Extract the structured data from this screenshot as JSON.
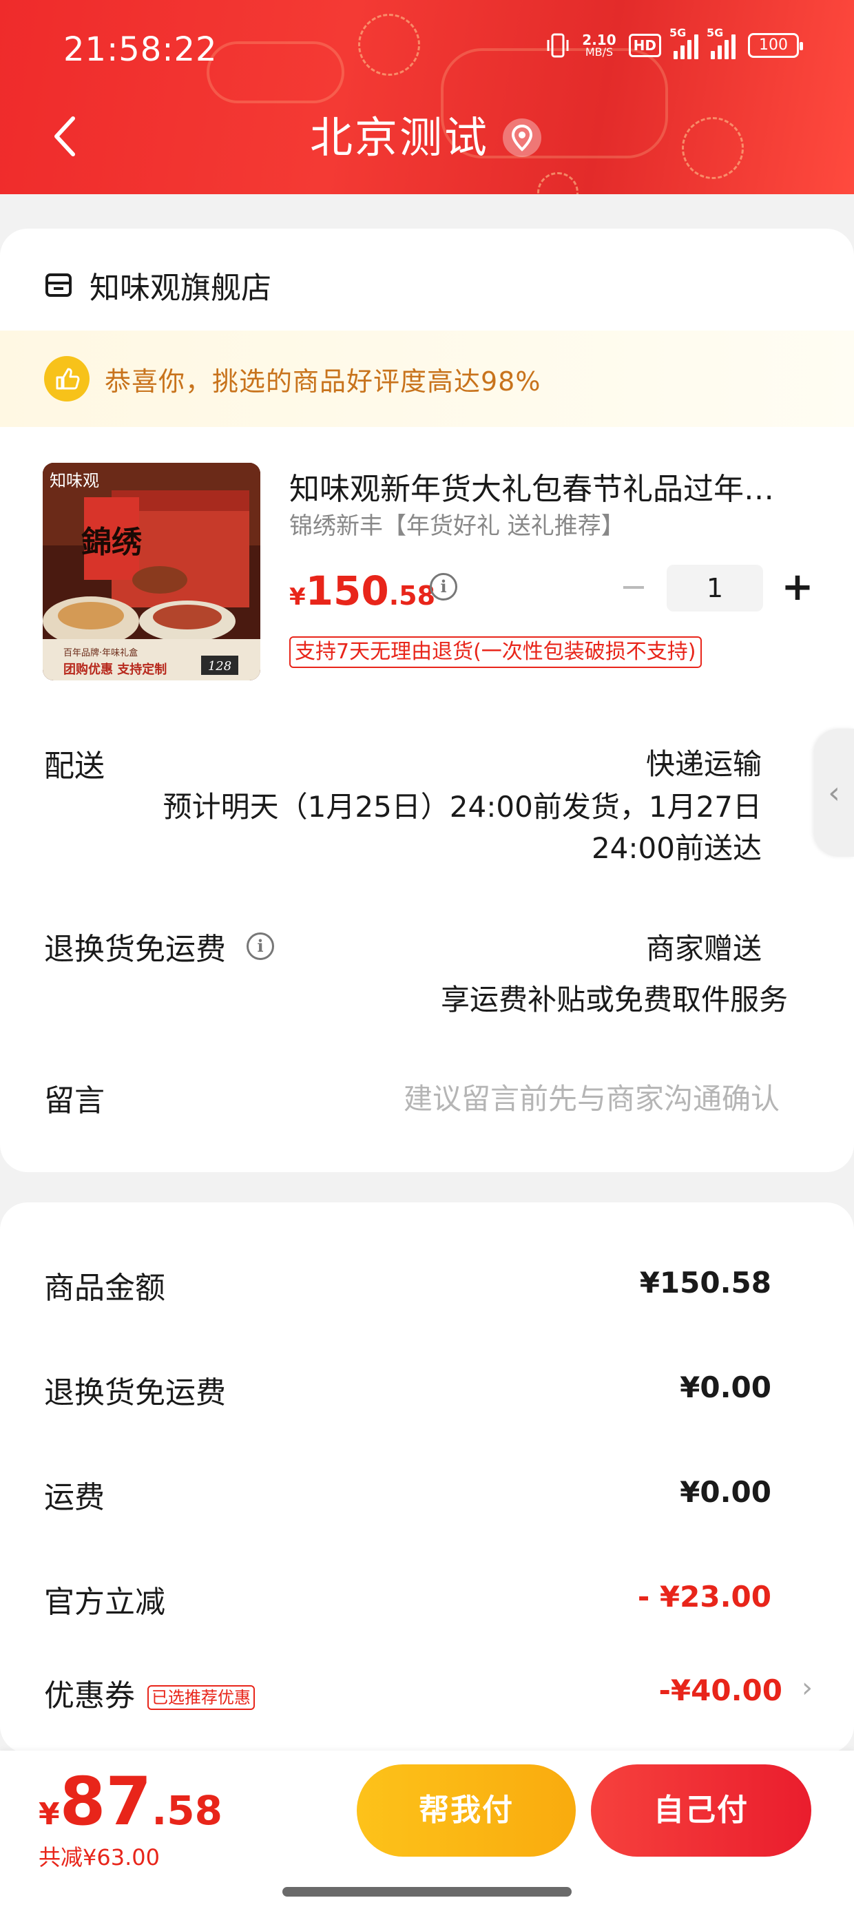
{
  "status_bar": {
    "time": "21:58:22",
    "net_speed_value": "2.10",
    "net_speed_unit": "MB/S",
    "hd_label": "HD",
    "sim1_label": "5G",
    "sim2_label": "5G",
    "battery": "100"
  },
  "header": {
    "title": "北京测试",
    "icons": [
      "back-arrow-icon",
      "location-pin-icon"
    ]
  },
  "store": {
    "name": "知味观旗舰店",
    "icon": "store-icon"
  },
  "banner": {
    "text": "恭喜你，挑选的商品好评度高达98%",
    "icon": "thumbs-up-icon"
  },
  "product": {
    "title": "知味观新年货大礼包春节礼品过年…",
    "subtitle": "锦绣新丰【年货好礼 送礼推荐】",
    "price_symbol": "¥",
    "price_int": "150",
    "price_dec": ".58",
    "quantity": "1",
    "return_policy": "支持7天无理由退货(一次性包装破损不支持)",
    "image_texts": {
      "brand": "知味观",
      "box_title": "錦绣",
      "tagline": "百年品牌·年味礼盒",
      "promo": "团购优惠 支持定制",
      "badge": "128"
    }
  },
  "delivery": {
    "label": "配送",
    "method": "快递运输",
    "detail_line1": "预计明天（1月25日）24:00前发货，1月27日",
    "detail_line2": "24:00前送达"
  },
  "return_shipping": {
    "label": "退换货免运费",
    "value": "商家赠送",
    "detail": "享运费补贴或免费取件服务"
  },
  "message": {
    "label": "留言",
    "placeholder": "建议留言前先与商家沟通确认"
  },
  "summary": {
    "rows": [
      {
        "label": "商品金额",
        "value": "¥150.58"
      },
      {
        "label": "退换货免运费",
        "value": "¥0.00"
      },
      {
        "label": "运费",
        "value": "¥0.00"
      },
      {
        "label": "官方立减",
        "value": "- ¥23.00"
      },
      {
        "label": "优惠券",
        "value": "-¥40.00",
        "tag": "已选推荐优惠"
      }
    ]
  },
  "footer": {
    "total_symbol": "¥",
    "total_int": "87",
    "total_dec": ".58",
    "saved": "共减¥63.00",
    "help_pay": "帮我付",
    "self_pay": "自己付"
  },
  "colors": {
    "accent_red": "#e8251a",
    "header_red": "#ef2b2b",
    "help_button": "#fdc21a",
    "self_button": "#f6413d",
    "banner_text": "#c8731c"
  }
}
